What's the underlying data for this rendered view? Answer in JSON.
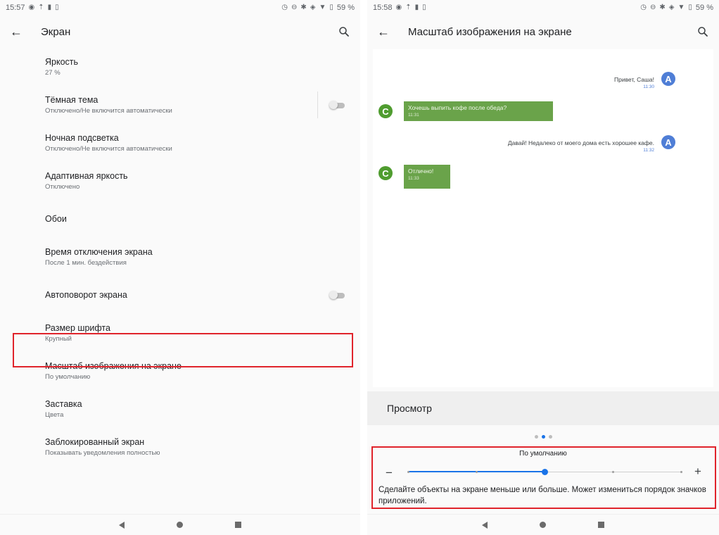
{
  "left": {
    "status": {
      "time": "15:57",
      "battery": "59 %"
    },
    "appbar": {
      "title": "Экран"
    },
    "items": [
      {
        "label": "Яркость",
        "summary": "27 %"
      },
      {
        "label": "Тёмная тема",
        "summary": "Отключено/Не включится автоматически",
        "toggle": "off"
      },
      {
        "label": "Ночная подсветка",
        "summary": "Отключено/Не включится автоматически"
      },
      {
        "label": "Адаптивная яркость",
        "summary": "Отключено"
      },
      {
        "label": "Обои",
        "summary": ""
      },
      {
        "label": "Время отключения экрана",
        "summary": "После 1 мин. бездействия"
      },
      {
        "label": "Автоповорот экрана",
        "summary": "",
        "toggle": "off"
      },
      {
        "label": "Размер шрифта",
        "summary": "Крупный"
      },
      {
        "label": "Масштаб изображения на экране",
        "summary": "По умолчанию",
        "highlighted": true
      },
      {
        "label": "Заставка",
        "summary": "Цвета"
      },
      {
        "label": "Заблокированный экран",
        "summary": "Показывать уведомления полностью"
      }
    ]
  },
  "right": {
    "status": {
      "time": "15:58",
      "battery": "59 %"
    },
    "appbar": {
      "title": "Масштаб изображения на экране"
    },
    "preview": {
      "messages": [
        {
          "side": "right",
          "avatar": "A",
          "text": "Привет, Саша!",
          "time": "11:30"
        },
        {
          "side": "left",
          "avatar": "C",
          "text": "Хочешь выпить кофе после обеда?",
          "time": "11:31"
        },
        {
          "side": "right",
          "avatar": "A",
          "text": "Давай! Недалеко от моего дома есть хорошее кафе.",
          "time": "11:32"
        },
        {
          "side": "left",
          "avatar": "C",
          "text": "Отлично!",
          "time": "11:33"
        }
      ],
      "label": "Просмотр",
      "page_count": 3,
      "page_active": 1
    },
    "scale": {
      "value_label": "По умолчанию",
      "minus": "−",
      "plus": "+",
      "steps": 5,
      "current_step": 2,
      "description": "Сделайте объекты на экране меньше или больше. Может измениться порядок значков приложений."
    }
  },
  "colors": {
    "accent": "#1a73e8",
    "highlight": "#e0232b",
    "avatar_a": "#4f7ed6",
    "avatar_c": "#4f9c2f",
    "bubble_green": "#6aa34a"
  }
}
